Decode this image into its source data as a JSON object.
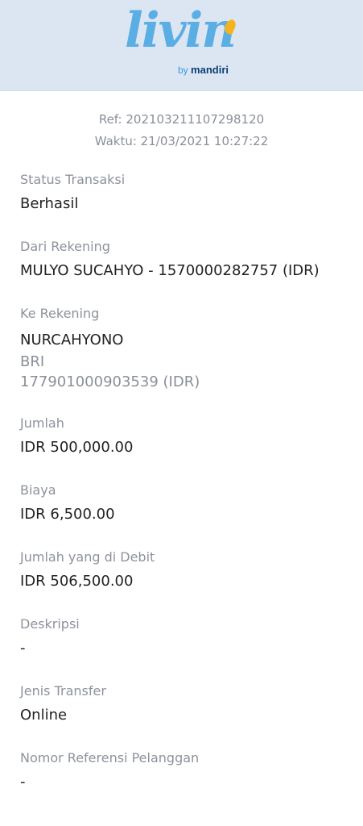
{
  "header": {
    "logo_word": "livin",
    "logo_by": "by",
    "logo_brand": "mandiri",
    "bg_color": "#dce6f2",
    "logo_color": "#5aaee3",
    "accent_color": "#f4b31d"
  },
  "receipt": {
    "ref": "Ref: 202103211107298120",
    "time": "Waktu: 21/03/2021 10:27:22"
  },
  "fields": {
    "status": {
      "label": "Status Transaksi",
      "value": "Berhasil"
    },
    "from": {
      "label": "Dari Rekening",
      "value": "MULYO SUCAHYO - 1570000282757 (IDR)"
    },
    "to": {
      "label": "Ke Rekening",
      "name": "NURCAHYONO",
      "bank": "BRI",
      "account": "177901000903539 (IDR)"
    },
    "amount": {
      "label": "Jumlah",
      "value": "IDR 500,000.00"
    },
    "fee": {
      "label": "Biaya",
      "value": "IDR 6,500.00"
    },
    "debited": {
      "label": "Jumlah yang di Debit",
      "value": "IDR 506,500.00"
    },
    "description": {
      "label": "Deskripsi",
      "value": "-"
    },
    "transfer_type": {
      "label": "Jenis Transfer",
      "value": "Online"
    },
    "customer_ref": {
      "label": "Nomor Referensi Pelanggan",
      "value": "-"
    }
  }
}
